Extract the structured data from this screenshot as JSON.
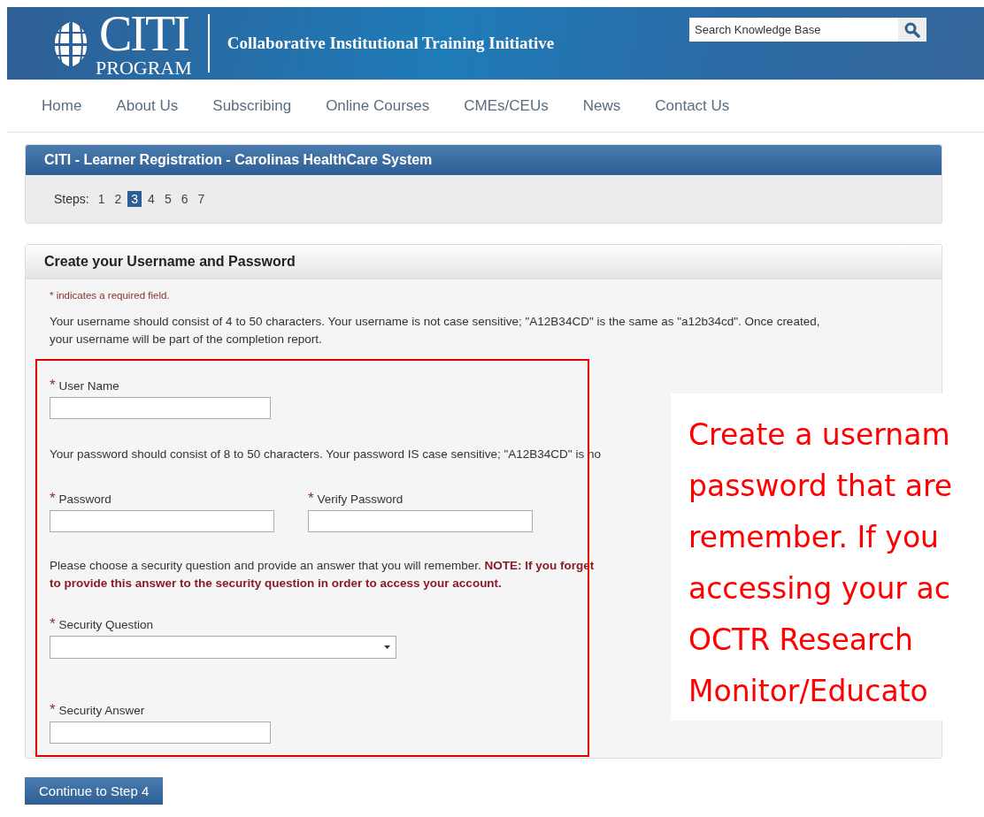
{
  "header": {
    "logo_word": "CITI",
    "logo_sub": "PROGRAM",
    "tagline": "Collaborative Institutional Training Initiative",
    "search": {
      "placeholder": "Search Knowledge Base"
    }
  },
  "nav": [
    {
      "label": "Home"
    },
    {
      "label": "About Us"
    },
    {
      "label": "Subscribing"
    },
    {
      "label": "Online Courses"
    },
    {
      "label": "CMEs/CEUs"
    },
    {
      "label": "News"
    },
    {
      "label": "Contact Us"
    }
  ],
  "registration": {
    "title": "CITI - Learner Registration - Carolinas HealthCare System",
    "steps_label": "Steps:",
    "steps": [
      {
        "label": "1",
        "selected": false
      },
      {
        "label": "2",
        "selected": false
      },
      {
        "label": "3",
        "selected": true
      },
      {
        "label": "4",
        "selected": false
      },
      {
        "label": "5",
        "selected": false
      },
      {
        "label": "6",
        "selected": false
      },
      {
        "label": "7",
        "selected": false
      }
    ]
  },
  "form": {
    "title": "Create your Username and Password",
    "required_note": "* indicates a required field.",
    "username_help": "Your username should consist of 4 to 50 characters. Your username is not case sensitive; \"A12B34CD\" is the same as \"a12b34cd\". Once created, your username will be part of the completion report.",
    "username": {
      "star": "*",
      "label": "User Name"
    },
    "password_help": "Your password should consist of 8 to 50 characters. Your password IS case sensitive; \"A12B34CD\" is no",
    "password": {
      "star": "*",
      "label": "Password"
    },
    "verify": {
      "star": "*",
      "label": "Verify Password"
    },
    "security_help": "Please choose a security question and provide an answer that you will remember. **NOTE: If you forget**",
    "security_warning": "to provide this answer to the security question in order to access your account.",
    "question": {
      "star": "*",
      "label": "Security Question"
    },
    "answer": {
      "star": "*",
      "label": "Security Answer"
    }
  },
  "continue_button": "Continue to Step 4",
  "callout": {
    "lines": [
      "Create a usernam",
      "password that are",
      "remember. If you",
      "accessing your ac",
      "OCTR Research",
      "Monitor/Educato"
    ]
  }
}
